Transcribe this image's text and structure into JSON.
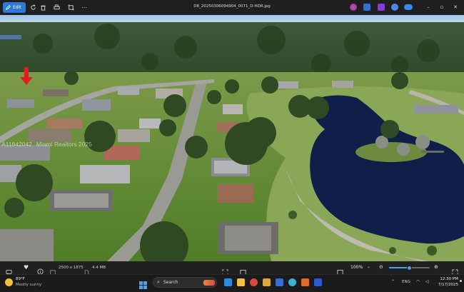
{
  "titlebar": {
    "edit_label": "Edit",
    "filename": "D8_20250306094904_0071_D-HDR.jpg"
  },
  "photo": {
    "watermark": "A11842042",
    "watermark_brand": "Miami Realtors 2025"
  },
  "infobar": {
    "dimensions": "2500 x 1875",
    "file_size": "4.4 MB",
    "zoom": "100%",
    "zoom_fraction": 0.5
  },
  "taskbar": {
    "temperature": "89°F",
    "weather": "Mostly sunny",
    "search_placeholder": "Search",
    "language": "ENG",
    "time": "12:30 PM",
    "date": "7/17/2025"
  },
  "colors": {
    "accent": "#2b7bd6",
    "pond": "#0f1f4a",
    "grass": "#5d8a2c"
  }
}
